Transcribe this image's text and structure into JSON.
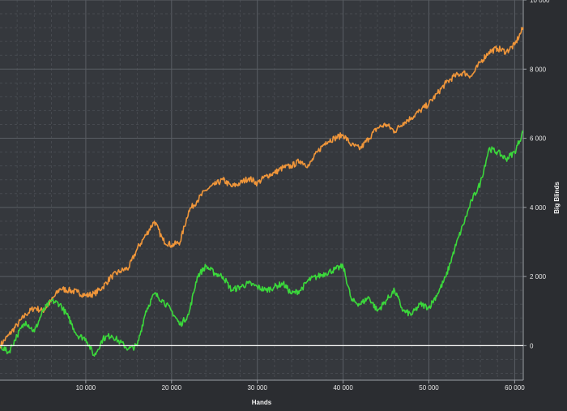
{
  "chart_data": {
    "type": "line",
    "xlabel": "Hands",
    "ylabel": "Big Blinds",
    "xlim": [
      0,
      61000
    ],
    "ylim": [
      -1000,
      10000
    ],
    "x_ticks": [
      10000,
      20000,
      30000,
      40000,
      50000,
      60000
    ],
    "x_tick_labels": [
      "10 000",
      "20 000",
      "30 000",
      "40 000",
      "50 000",
      "60 000"
    ],
    "y_ticks": [
      0,
      2000,
      4000,
      6000,
      8000,
      10000
    ],
    "y_tick_labels": [
      "0",
      "2 000",
      "4 000",
      "6 000",
      "8 000",
      "10 000"
    ],
    "grid": true,
    "zero_line": true,
    "series": [
      {
        "color": "#f0963a",
        "x": [
          0,
          1000,
          2000,
          3000,
          4000,
          5000,
          6000,
          7000,
          8000,
          9000,
          10000,
          11000,
          12000,
          13000,
          14000,
          15000,
          16000,
          17000,
          18000,
          19000,
          20000,
          21000,
          22000,
          23000,
          24000,
          25000,
          26000,
          27000,
          28000,
          29000,
          30000,
          31000,
          32000,
          33000,
          34000,
          35000,
          36000,
          37000,
          38000,
          39000,
          40000,
          41000,
          42000,
          43000,
          44000,
          45000,
          46000,
          47000,
          48000,
          49000,
          50000,
          51000,
          52000,
          53000,
          54000,
          55000,
          56000,
          57000,
          58000,
          59000,
          60000,
          61000
        ],
        "values": [
          0,
          300,
          600,
          900,
          1100,
          1000,
          1300,
          1650,
          1600,
          1550,
          1450,
          1500,
          1700,
          2000,
          2150,
          2250,
          2800,
          3200,
          3600,
          3050,
          2900,
          3000,
          3900,
          4200,
          4500,
          4650,
          4800,
          4600,
          4700,
          4850,
          4700,
          4900,
          5000,
          5150,
          5200,
          5350,
          5200,
          5600,
          5900,
          6000,
          6100,
          5800,
          5700,
          6000,
          6300,
          6400,
          6200,
          6450,
          6600,
          6800,
          7000,
          7300,
          7600,
          7800,
          7900,
          7800,
          8200,
          8500,
          8600,
          8500,
          8700,
          9200
        ]
      },
      {
        "color": "#3bd83b",
        "x": [
          0,
          1000,
          2000,
          3000,
          4000,
          5000,
          6000,
          7000,
          8000,
          9000,
          10000,
          11000,
          12000,
          13000,
          14000,
          15000,
          16000,
          17000,
          18000,
          19000,
          20000,
          21000,
          22000,
          23000,
          24000,
          25000,
          26000,
          27000,
          28000,
          29000,
          30000,
          31000,
          32000,
          33000,
          34000,
          35000,
          36000,
          37000,
          38000,
          39000,
          40000,
          41000,
          42000,
          43000,
          44000,
          45000,
          46000,
          47000,
          48000,
          49000,
          50000,
          51000,
          52000,
          53000,
          54000,
          55000,
          56000,
          57000,
          58000,
          59000,
          60000,
          61000
        ],
        "values": [
          0,
          -200,
          300,
          700,
          400,
          1000,
          1300,
          1200,
          800,
          300,
          200,
          -300,
          200,
          300,
          100,
          -100,
          0,
          1000,
          1500,
          1300,
          1000,
          600,
          900,
          2000,
          2300,
          2100,
          2000,
          1600,
          1700,
          1800,
          1700,
          1600,
          1700,
          1800,
          1500,
          1600,
          1900,
          2000,
          2100,
          2200,
          2300,
          1300,
          1200,
          1400,
          1000,
          1300,
          1600,
          1000,
          900,
          1200,
          1100,
          1500,
          2000,
          2800,
          3500,
          4200,
          4700,
          5700,
          5600,
          5400,
          5600,
          6200
        ]
      }
    ]
  }
}
